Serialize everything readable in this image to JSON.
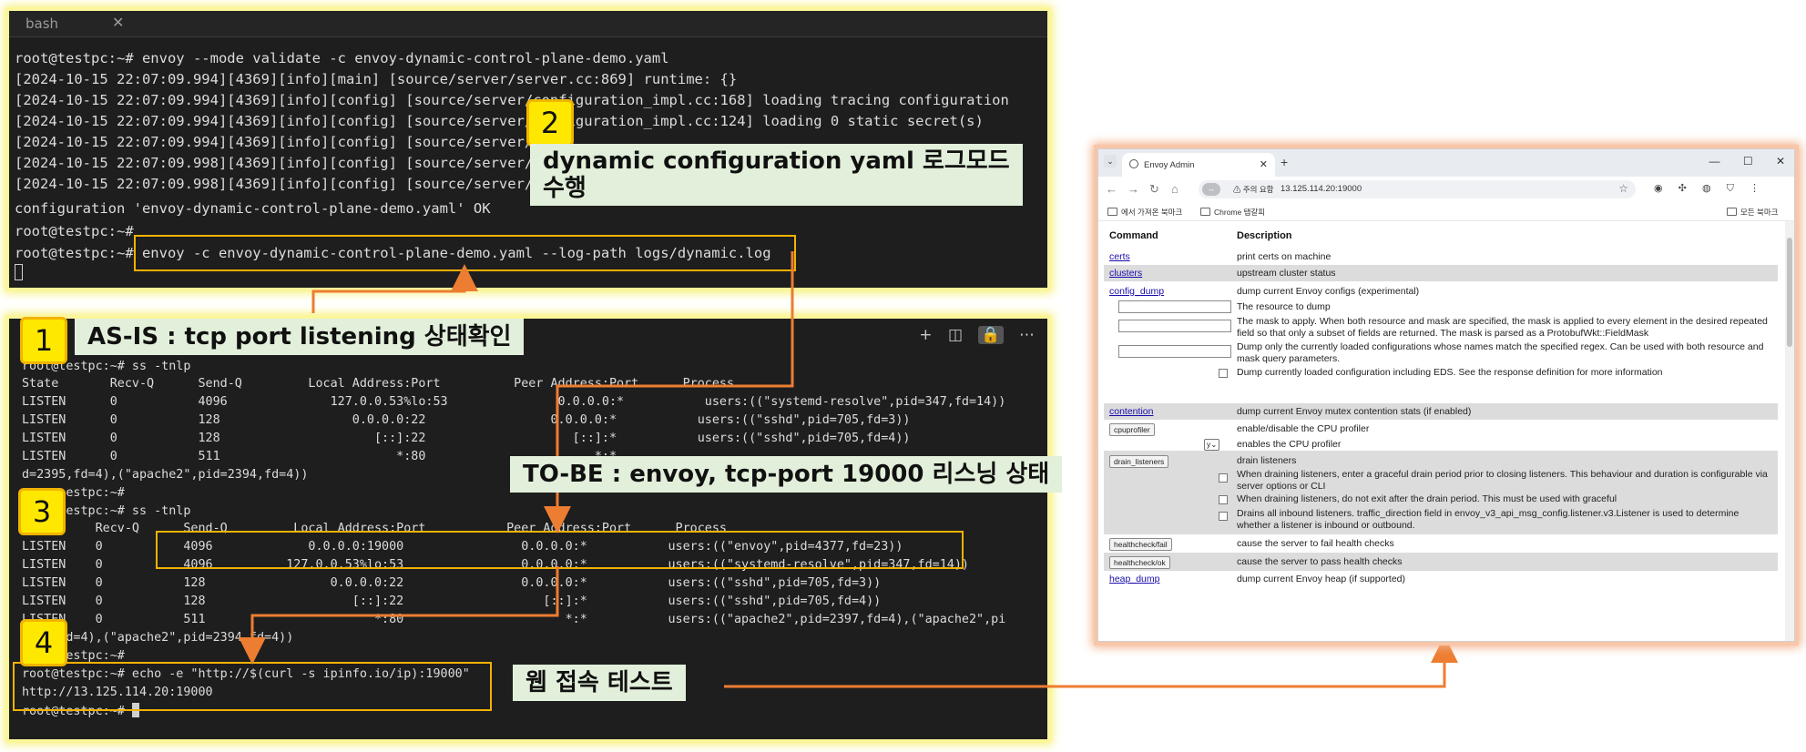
{
  "terminal1": {
    "tab_title": "bash",
    "lines": [
      "root@testpc:~# envoy --mode validate -c envoy-dynamic-control-plane-demo.yaml",
      "[2024-10-15 22:07:09.994][4369][info][main] [source/server/server.cc:869] runtime: {}",
      "[2024-10-15 22:07:09.994][4369][info][config] [source/server/configuration_impl.cc:168] loading tracing configuration",
      "[2024-10-15 22:07:09.994][4369][info][config] [source/server/configuration_impl.cc:124] loading 0 static secret(s)",
      "[2024-10-15 22:07:09.994][4369][info][config] [source/server/",
      "[2024-10-15 22:07:09.998][4369][info][config] [source/server/",
      "[2024-10-15 22:07:09.998][4369][info][config] [source/server/",
      "configuration 'envoy-dynamic-control-plane-demo.yaml' OK",
      "root@testpc:~#",
      "root@testpc:~# envoy -c envoy-dynamic-control-plane-demo.yaml --log-path logs/dynamic.log"
    ]
  },
  "terminal2": {
    "icons": [
      "plus-icon",
      "split-icon",
      "lock-icon",
      "more-icon"
    ],
    "lines": [
      "root@testpc:~# ss -tnlp",
      "State       Recv-Q      Send-Q         Local Address:Port          Peer Address:Port      Process",
      "LISTEN      0           4096              127.0.0.53%lo:53               0.0.0.0:*           users:((\"systemd-resolve\",pid=347,fd=14))",
      "LISTEN      0           128                  0.0.0.0:22                 0.0.0.0:*           users:((\"sshd\",pid=705,fd=3))",
      "LISTEN      0           128                     [::]:22                    [::]:*           users:((\"sshd\",pid=705,fd=4))",
      "LISTEN      0           511                        *:80                       *:*",
      "d=2395,fd=4),(\"apache2\",pid=2394,fd=4))",
      "      estpc:~#",
      "      estpc:~# ss -tnlp",
      "State     Recv-Q      Send-Q         Local Address:Port           Peer Address:Port      Process",
      "LISTEN    0           4096             0.0.0.0:19000                0.0.0.0:*           users:((\"envoy\",pid=4377,fd=23))",
      "LISTEN    0           4096          127.0.0.53%lo:53                0.0.0.0:*           users:((\"systemd-resolve\",pid=347,fd=14))",
      "LISTEN    0           128                 0.0.0.0:22                0.0.0.0:*           users:((\"sshd\",pid=705,fd=3))",
      "LISTEN    0           128                    [::]:22                   [::]:*           users:((\"sshd\",pid=705,fd=4))",
      "LISTEN    0           511                       *:80                      *:*           users:((\"apache2\",pid=2397,fd=4),(\"apache2\",pi",
      "      d=4),(\"apache2\",pid=2394,fd=4))",
      "      estpc:~#",
      "root@testpc:~# echo -e \"http://$(curl -s ipinfo.io/ip):19000\"",
      "http://13.125.114.20:19000",
      "root@testpc:~# "
    ]
  },
  "callouts": {
    "n1": "1",
    "n2": "2",
    "n3": "3",
    "n4": "4",
    "c1": "AS-IS : tcp port listening 상태확인",
    "c2_line1": "dynamic configuration yaml 로그모드",
    "c2_line2": "수행",
    "c3": "TO-BE : envoy, tcp-port 19000 리스닝 상태",
    "c4": "웹 접속 테스트"
  },
  "colors": {
    "terminal_bg": "#1e1e1e",
    "highlight_box": "#f2b200",
    "arrow": "#ed7d31",
    "callout_bg": "#e2efda",
    "number_badge": "#ffe800"
  },
  "browser": {
    "tab_title": "Envoy Admin",
    "new_tab": "+",
    "security_chip": "↔",
    "warning_text": "⚠ 주의 요함",
    "url": "13.125.114.20:19000",
    "bookmarks": [
      "에서 가져온 북마크",
      "Chrome 탭갈피",
      "모든 북마크"
    ],
    "table_headers": {
      "command": "Command",
      "description": "Description"
    },
    "rows": [
      {
        "cmd": "certs",
        "desc": "print certs on machine"
      },
      {
        "cmd": "clusters",
        "desc": "upstream cluster status"
      },
      {
        "cmd": "config_dump",
        "desc": "dump current Envoy configs (experimental)"
      },
      {
        "desc": "The resource to dump"
      },
      {
        "desc": "The mask to apply. When both resource and mask are specified, the mask is applied to every element in the desired repeated field so that only a subset of fields are returned. The mask is parsed as a ProtobufWkt::FieldMask"
      },
      {
        "desc": "Dump only the currently loaded configurations whose names match the specified regex. Can be used with both resource and mask query parameters."
      },
      {
        "desc": "Dump currently loaded configuration including EDS. See the response definition for more information"
      },
      {
        "cmd": "contention",
        "desc": "dump current Envoy mutex contention stats (if enabled)"
      },
      {
        "cmd": "cpuprofiler",
        "desc": "enable/disable the CPU profiler"
      },
      {
        "select": "y",
        "desc": "enables the CPU profiler"
      },
      {
        "cmd": "drain_listeners",
        "desc": "drain listeners"
      },
      {
        "desc": "When draining listeners, enter a graceful drain period prior to closing listeners. This behaviour and duration is configurable via server options or CLI"
      },
      {
        "desc": "When draining listeners, do not exit after the drain period. This must be used with graceful"
      },
      {
        "desc": "Drains all inbound listeners. traffic_direction field in envoy_v3_api_msg_config.listener.v3.Listener is used to determine whether a listener is inbound or outbound."
      },
      {
        "cmd": "healthcheck/fail",
        "desc": "cause the server to fail health checks"
      },
      {
        "cmd": "healthcheck/ok",
        "desc": "cause the server to pass health checks"
      },
      {
        "cmd": "heap_dump",
        "desc": "dump current Envoy heap (if supported)"
      }
    ]
  }
}
